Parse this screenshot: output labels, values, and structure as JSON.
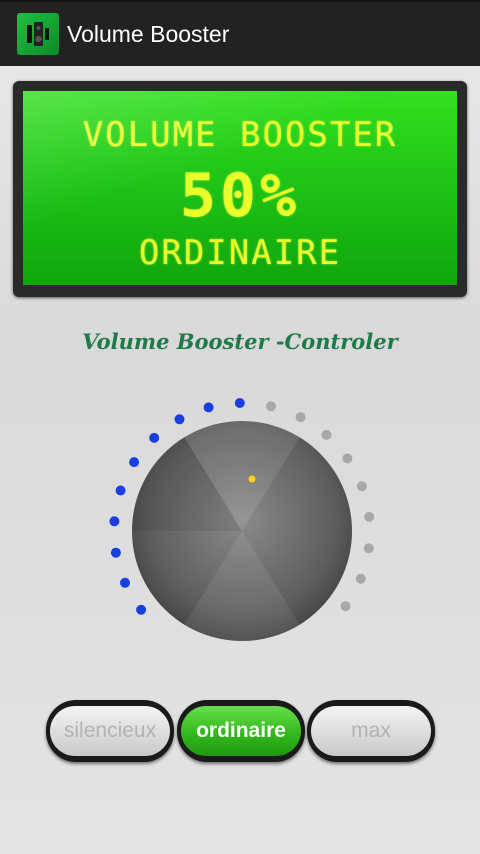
{
  "app": {
    "title": "Volume Booster",
    "icon": "speaker-app-icon"
  },
  "display": {
    "title": "VOLUME BOOSTER",
    "percent": "50%",
    "mode": "ORDINAIRE",
    "background_color": "#1fc516",
    "text_color": "#e9ff2a"
  },
  "controller": {
    "label": "Volume Booster -Controler",
    "level": 0.5,
    "dots_total": 19,
    "dots_active": 10,
    "active_color": "#1a3fe0",
    "inactive_color": "#a8a8a8",
    "indicator_color": "#ffd21a"
  },
  "modes": {
    "silencieux": "silencieux",
    "ordinaire": "ordinaire",
    "max": "max",
    "selected": "ordinaire"
  },
  "colors": {
    "accent_green": "#34b81c",
    "action_bar": "#222222",
    "label_green": "#1f7a4a"
  }
}
